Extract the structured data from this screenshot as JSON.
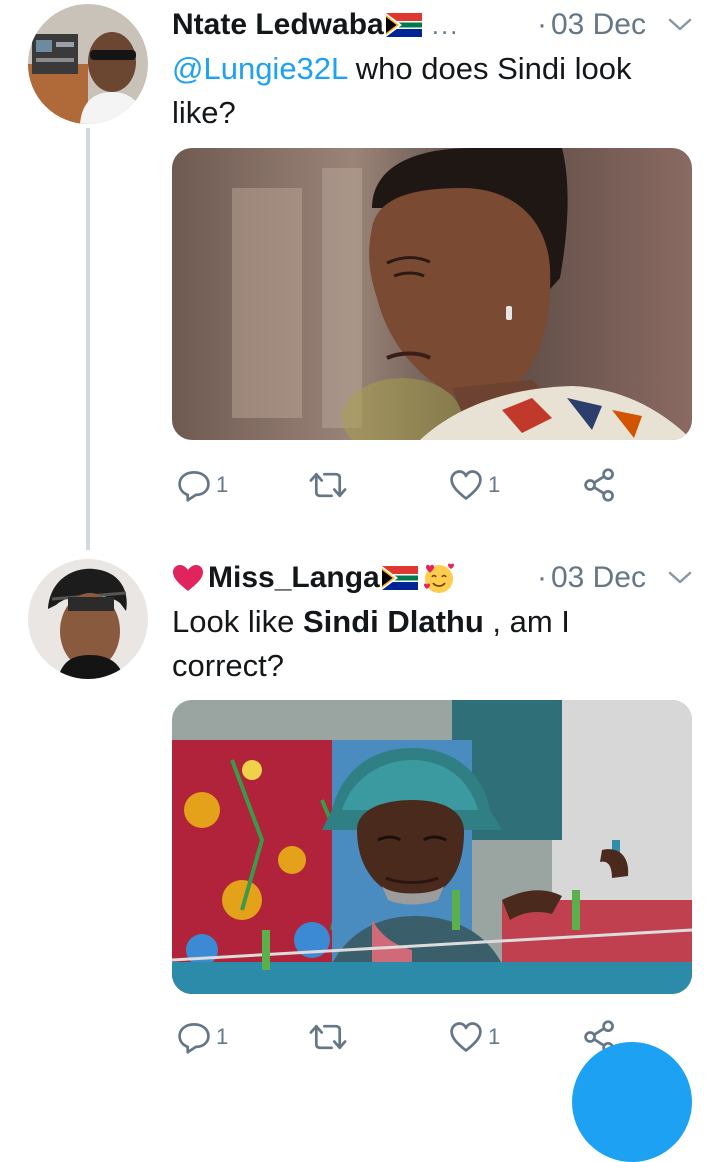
{
  "tweets": [
    {
      "name": "Ntate Ledwaba",
      "more": "...",
      "dot": "·",
      "date": "03 Dec",
      "text_mention": "@Lungie32L",
      "text_rest": " who does Sindi look like?",
      "reply_count": "1",
      "like_count": "1"
    },
    {
      "name": "Miss_Langa",
      "dot": "·",
      "date": "03 Dec",
      "text_pre": "Look like ",
      "text_bold": "Sindi Dlathu",
      "text_post": " , am I correct?",
      "reply_count": "1",
      "like_count": "1"
    }
  ],
  "icons": [
    "reply-icon",
    "retweet-icon",
    "like-icon",
    "share-icon",
    "chevron-down-icon",
    "south-africa-flag-icon",
    "heart-icon",
    "smiling-face-with-hearts-icon"
  ],
  "colors": {
    "accent": "#1da1f2",
    "muted": "#657786",
    "text": "#14171a",
    "thread": "#cfd9de",
    "heart": "#e0245e"
  }
}
